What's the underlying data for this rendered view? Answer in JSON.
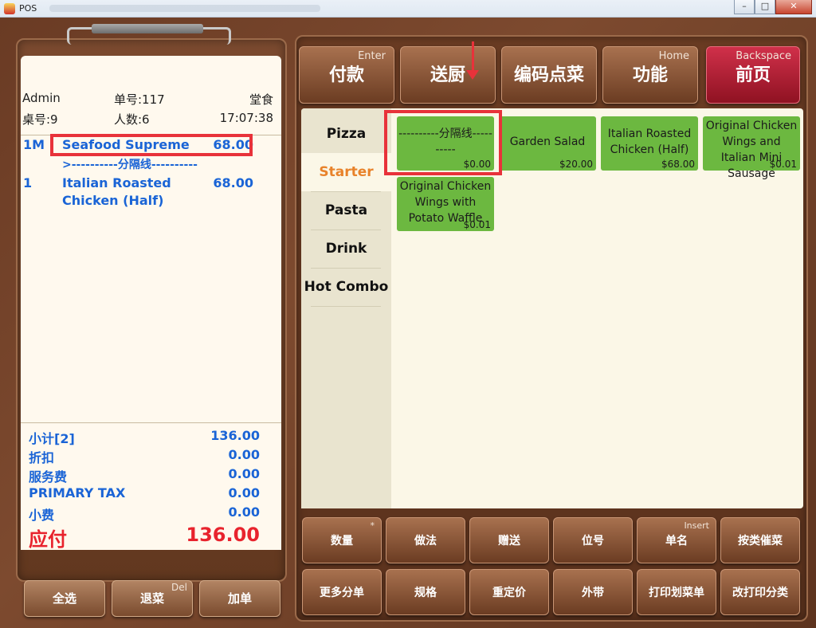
{
  "window": {
    "title": "POS",
    "controls": {
      "minimize": "–",
      "maximize": "□",
      "close": "✕"
    }
  },
  "receipt": {
    "header": {
      "user": "Admin",
      "order_no": "单号:117",
      "dine_type": "堂食",
      "table_no": "桌号:9",
      "guests": "人数:6",
      "time": "17:07:38"
    },
    "lines": [
      {
        "qty": "1M",
        "name": "Seafood Supreme",
        "price": "68.00"
      },
      {
        "separator": ">----------分隔线----------"
      },
      {
        "qty": "1",
        "name": "Italian Roasted",
        "name2": "Chicken (Half)",
        "price": "68.00"
      }
    ],
    "totals": {
      "subtotal_label": "小计[2]",
      "subtotal": "136.00",
      "discount_label": "折扣",
      "discount": "0.00",
      "service_label": "服务费",
      "service": "0.00",
      "tax_label": "PRIMARY TAX",
      "tax": "0.00",
      "tip_label": "小费",
      "tip": "0.00",
      "due_label": "应付",
      "due": "136.00"
    }
  },
  "left_buttons": {
    "select_all": "全选",
    "return_dish": "退菜",
    "return_hotkey": "Del",
    "add_order": "加单"
  },
  "top_buttons": [
    {
      "label": "付款",
      "hotkey": "Enter"
    },
    {
      "label": "送厨",
      "hotkey": ""
    },
    {
      "label": "编码点菜",
      "hotkey": ""
    },
    {
      "label": "功能",
      "hotkey": "Home"
    },
    {
      "label": "前页",
      "hotkey": "Backspace"
    }
  ],
  "categories": [
    "Pizza",
    "Starter",
    "Pasta",
    "Drink",
    "Hot Combo"
  ],
  "active_category": "Starter",
  "dishes": [
    {
      "name": "----------分隔线----------",
      "price": "$0.00"
    },
    {
      "name": "Garden Salad",
      "price": "$20.00"
    },
    {
      "name": "Italian Roasted Chicken (Half)",
      "price": "$68.00"
    },
    {
      "name": "Original Chicken Wings and Italian Mini Sausage",
      "price": "$0.01"
    },
    {
      "name": "Original Chicken Wings with Potato Waffle",
      "price": "$0.01"
    }
  ],
  "bottom_buttons": [
    {
      "label": "数量",
      "hotkey": "*"
    },
    {
      "label": "做法",
      "hotkey": ""
    },
    {
      "label": "赠送",
      "hotkey": ""
    },
    {
      "label": "位号",
      "hotkey": ""
    },
    {
      "label": "单名",
      "hotkey": "Insert"
    },
    {
      "label": "按类催菜",
      "hotkey": ""
    },
    {
      "label": "更多分单",
      "hotkey": ""
    },
    {
      "label": "规格",
      "hotkey": ""
    },
    {
      "label": "重定价",
      "hotkey": ""
    },
    {
      "label": "外带",
      "hotkey": ""
    },
    {
      "label": "打印划菜单",
      "hotkey": ""
    },
    {
      "label": "改打印分类",
      "hotkey": ""
    }
  ],
  "colors": {
    "accent_red": "#e8323a",
    "dish_green": "#6cb840",
    "active_cat": "#e8822a",
    "receipt_blue": "#1a64d6"
  }
}
